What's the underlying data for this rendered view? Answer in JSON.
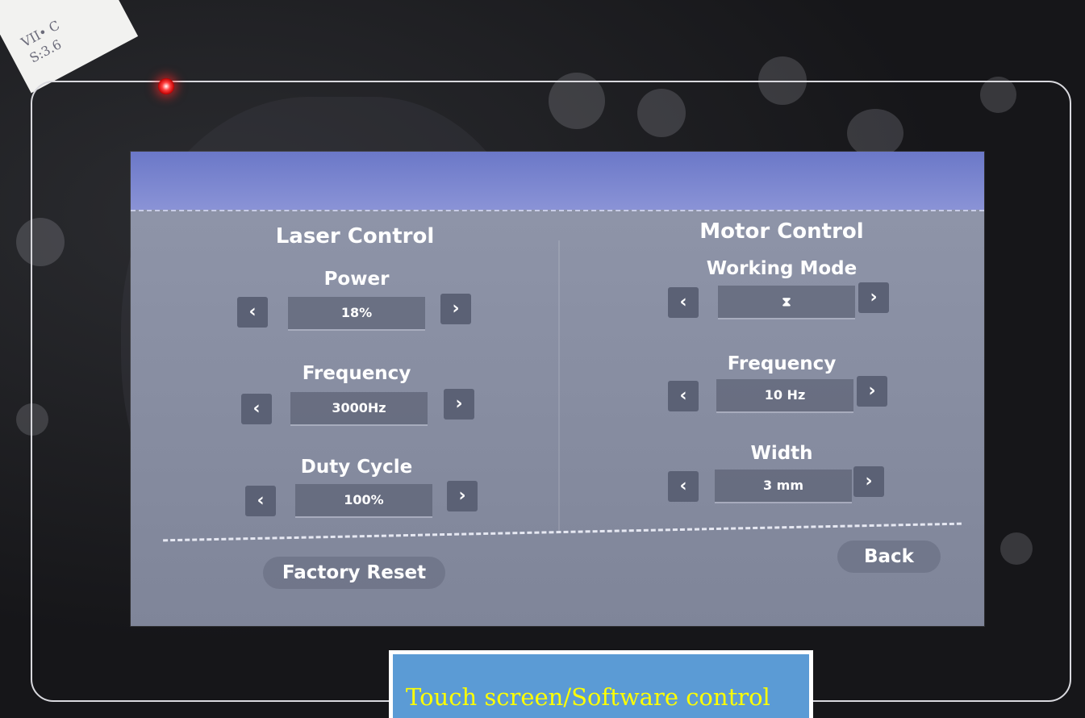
{
  "sticker": {
    "text": "VII• C\nS:3.6"
  },
  "laser": {
    "title": "Laser Control",
    "params": [
      {
        "label": "Power",
        "value": "18%"
      },
      {
        "label": "Frequency",
        "value": "3000Hz"
      },
      {
        "label": "Duty Cycle",
        "value": "100%"
      }
    ]
  },
  "motor": {
    "title": "Motor Control",
    "params": [
      {
        "label": "Working Mode",
        "value": "⧗"
      },
      {
        "label": "Frequency",
        "value": "10 Hz"
      },
      {
        "label": "Width",
        "value": "3 mm"
      }
    ]
  },
  "arrows": {
    "left": "‹",
    "right": "›"
  },
  "footer": {
    "factory_reset": "Factory Reset",
    "back": "Back"
  },
  "caption": {
    "text": "Touch screen/Software control"
  },
  "colors": {
    "header": "#6b78c8",
    "panel": "#8d93a6",
    "caption_bg": "#5b9bd5",
    "caption_text": "#ffff00",
    "led": "#ff2020"
  }
}
